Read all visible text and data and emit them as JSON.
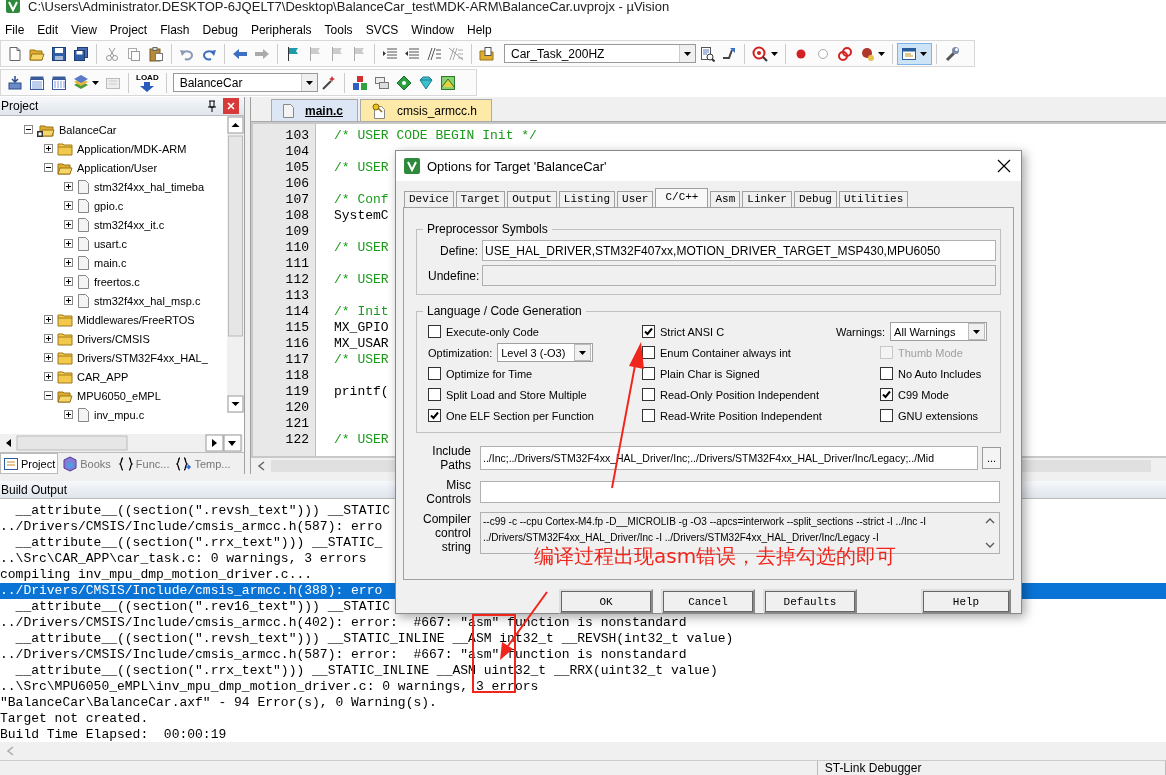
{
  "window": {
    "title": "C:\\Users\\Administrator.DESKTOP-6JQELT7\\Desktop\\BalanceCar_test\\MDK-ARM\\BalanceCar.uvprojx - µVision"
  },
  "menu": [
    "File",
    "Edit",
    "View",
    "Project",
    "Flash",
    "Debug",
    "Peripherals",
    "Tools",
    "SVCS",
    "Window",
    "Help"
  ],
  "toolbar": {
    "function_combo": "Car_Task_200HZ",
    "load_label": "LOAD",
    "target_combo": "BalanceCar"
  },
  "project_panel": {
    "title": "Project",
    "tree": [
      {
        "label": "BalanceCar",
        "kind": "target",
        "expanded": true,
        "children": [
          {
            "label": "Application/MDK-ARM",
            "kind": "group",
            "expanded": false
          },
          {
            "label": "Application/User",
            "kind": "group",
            "expanded": true,
            "children": [
              {
                "label": "stm32f4xx_hal_timeba",
                "kind": "file",
                "expanded": false
              },
              {
                "label": "gpio.c",
                "kind": "file",
                "expanded": false
              },
              {
                "label": "stm32f4xx_it.c",
                "kind": "file",
                "expanded": false
              },
              {
                "label": "usart.c",
                "kind": "file",
                "expanded": false
              },
              {
                "label": "main.c",
                "kind": "file",
                "expanded": false
              },
              {
                "label": "freertos.c",
                "kind": "file",
                "expanded": false
              },
              {
                "label": "stm32f4xx_hal_msp.c",
                "kind": "file",
                "expanded": false
              }
            ]
          },
          {
            "label": "Middlewares/FreeRTOS",
            "kind": "group",
            "expanded": false
          },
          {
            "label": "Drivers/CMSIS",
            "kind": "group",
            "expanded": false
          },
          {
            "label": "Drivers/STM32F4xx_HAL_",
            "kind": "group",
            "expanded": false
          },
          {
            "label": "CAR_APP",
            "kind": "group",
            "expanded": false
          },
          {
            "label": "MPU6050_eMPL",
            "kind": "group",
            "expanded": true,
            "children": [
              {
                "label": "inv_mpu.c",
                "kind": "file",
                "expanded": false
              }
            ]
          }
        ]
      }
    ],
    "tabs": [
      {
        "label": "Project",
        "selected": true
      },
      {
        "label": "Books",
        "selected": false
      },
      {
        "label": "Func...",
        "selected": false
      },
      {
        "label": "Temp...",
        "selected": false
      }
    ]
  },
  "editor": {
    "tabs": [
      {
        "label": "main.c",
        "selected": true
      },
      {
        "label": "cmsis_armcc.h",
        "selected": false
      }
    ],
    "lines": [
      {
        "number": "103",
        "kind": "comment",
        "code": "/* USER CODE BEGIN Init */"
      },
      {
        "number": "104"
      },
      {
        "number": "105",
        "kind": "comment",
        "code": "/* USER"
      },
      {
        "number": "106"
      },
      {
        "number": "107",
        "kind": "comment",
        "code": "/* Conf"
      },
      {
        "number": "108",
        "kind": "code",
        "code": "SystemC"
      },
      {
        "number": "109"
      },
      {
        "number": "110",
        "kind": "comment",
        "code": "/* USER"
      },
      {
        "number": "111"
      },
      {
        "number": "112",
        "kind": "comment",
        "code": "/* USER"
      },
      {
        "number": "113"
      },
      {
        "number": "114",
        "kind": "comment",
        "code": "/* Init"
      },
      {
        "number": "115",
        "kind": "code",
        "code": "MX_GPIO"
      },
      {
        "number": "116",
        "kind": "code",
        "code": "MX_USAR"
      },
      {
        "number": "117",
        "kind": "comment",
        "code": "/* USER"
      },
      {
        "number": "118"
      },
      {
        "number": "119",
        "kind": "code",
        "code": "printf("
      },
      {
        "number": "120"
      },
      {
        "number": "121"
      },
      {
        "number": "122",
        "kind": "comment",
        "code": "/* USER"
      }
    ]
  },
  "build_output": {
    "title": "Build Output",
    "lines": [
      {
        "text": "  __attribute__((section(\".revsh_text\"))) __STATIC",
        "selected": false
      },
      {
        "text": "../Drivers/CMSIS/Include/cmsis_armcc.h(587): erro",
        "selected": false
      },
      {
        "text": "  __attribute__((section(\".rrx_text\"))) __STATIC_",
        "selected": false
      },
      {
        "text": "..\\Src\\CAR_APP\\car_task.c: 0 warnings, 3 errors",
        "selected": false
      },
      {
        "text": "compiling inv_mpu_dmp_motion_driver.c...",
        "selected": false
      },
      {
        "text": "../Drivers/CMSIS/Include/cmsis_armcc.h(388): erro",
        "selected": true
      },
      {
        "text": "  __attribute__((section(\".rev16_text\"))) __STATIC",
        "selected": false
      },
      {
        "text": "../Drivers/CMSIS/Include/cmsis_armcc.h(402): error:  #667: \"asm\" function is nonstandard",
        "selected": false
      },
      {
        "text": "  __attribute__((section(\".revsh_text\"))) __STATIC_INLINE __ASM int32_t __REVSH(int32_t value)",
        "selected": false
      },
      {
        "text": "../Drivers/CMSIS/Include/cmsis_armcc.h(587): error:  #667: \"asm\" function is nonstandard",
        "selected": false
      },
      {
        "text": "  __attribute__((section(\".rrx_text\"))) __STATIC_INLINE __ASM uint32_t __RRX(uint32_t value)",
        "selected": false
      },
      {
        "text": "..\\Src\\MPU6050_eMPL\\inv_mpu_dmp_motion_driver.c: 0 warnings, 3 errors",
        "selected": false
      },
      {
        "text": "\"BalanceCar\\BalanceCar.axf\" - 94 Error(s), 0 Warning(s).",
        "selected": false
      },
      {
        "text": "Target not created.",
        "selected": false
      },
      {
        "text": "Build Time Elapsed:  00:00:19",
        "selected": false
      }
    ]
  },
  "status_bar": {
    "debugger": "ST-Link Debugger"
  },
  "dialog": {
    "title": "Options for Target 'BalanceCar'",
    "tabs": [
      {
        "label": "Device",
        "selected": false
      },
      {
        "label": "Target",
        "selected": false
      },
      {
        "label": "Output",
        "selected": false
      },
      {
        "label": "Listing",
        "selected": false
      },
      {
        "label": "User",
        "selected": false
      },
      {
        "label": "C/C++",
        "selected": true
      },
      {
        "label": "Asm",
        "selected": false
      },
      {
        "label": "Linker",
        "selected": false
      },
      {
        "label": "Debug",
        "selected": false
      },
      {
        "label": "Utilities",
        "selected": false
      }
    ],
    "preprocessor": {
      "title": "Preprocessor Symbols",
      "define": {
        "label": "Define:",
        "value": "USE_HAL_DRIVER,STM32F407xx,MOTION_DRIVER_TARGET_MSP430,MPU6050",
        "disabled": false
      },
      "undefine": {
        "label": "Undefine:",
        "disabled": true
      }
    },
    "language": {
      "title": "Language / Code Generation",
      "columns": [
        [
          {
            "kind": "checkbox",
            "label": "Execute-only Code",
            "checked": false,
            "disabled": false
          },
          {
            "kind": "dropdown",
            "label": "Optimization:",
            "value": "Level 3 (-O3)"
          },
          {
            "kind": "checkbox",
            "label": "Optimize for Time",
            "checked": false,
            "disabled": false
          },
          {
            "kind": "checkbox",
            "label": "Split Load and Store Multiple",
            "checked": false,
            "disabled": false
          },
          {
            "kind": "checkbox",
            "label": "One ELF Section per Function",
            "checked": true,
            "disabled": false
          }
        ],
        [
          {
            "kind": "checkbox",
            "label": "Strict ANSI C",
            "checked": true,
            "disabled": false
          },
          {
            "kind": "checkbox",
            "label": "Enum Container always int",
            "checked": false,
            "disabled": false
          },
          {
            "kind": "checkbox",
            "label": "Plain Char is Signed",
            "checked": false,
            "disabled": false
          },
          {
            "kind": "checkbox",
            "label": "Read-Only Position Independent",
            "checked": false,
            "disabled": false
          },
          {
            "kind": "checkbox",
            "label": "Read-Write Position Independent",
            "checked": false,
            "disabled": false
          }
        ],
        [
          {
            "kind": "dropdown",
            "label": "Warnings:",
            "value": "All Warnings"
          },
          {
            "kind": "checkbox",
            "label": "Thumb Mode",
            "checked": false,
            "disabled": true
          },
          {
            "kind": "checkbox",
            "label": "No Auto Includes",
            "checked": false,
            "disabled": false
          },
          {
            "kind": "checkbox",
            "label": "C99 Mode",
            "checked": true,
            "disabled": false
          },
          {
            "kind": "checkbox",
            "label": "GNU extensions",
            "checked": false,
            "disabled": false
          }
        ]
      ]
    },
    "include_paths": {
      "label": "Include Paths",
      "value": "../Inc;../Drivers/STM32F4xx_HAL_Driver/Inc;../Drivers/STM32F4xx_HAL_Driver/Inc/Legacy;../Mid",
      "browse": "..."
    },
    "misc_controls": {
      "label": "Misc Controls"
    },
    "compiler_string": {
      "label": "Compiler control string",
      "lines": [
        "--c99 -c --cpu Cortex-M4.fp -D__MICROLIB -g -O3 --apcs=interwork --split_sections --strict -I ../Inc -I",
        "../Drivers/STM32F4xx_HAL_Driver/Inc -I ../Drivers/STM32F4xx_HAL_Driver/Inc/Legacy -I"
      ]
    },
    "buttons": [
      "OK",
      "Cancel",
      "Defaults",
      "Help"
    ]
  },
  "annotation": {
    "note": "编译过程出现asm错误，去掉勾选的即可"
  }
}
